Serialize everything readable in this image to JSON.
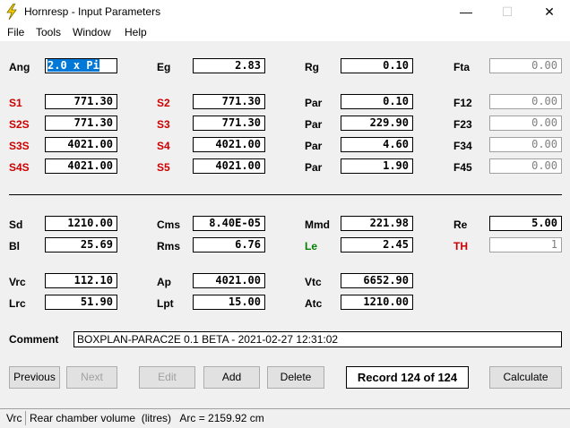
{
  "window": {
    "title": "Hornresp - Input Parameters",
    "minimize": "—",
    "maximize": "☐",
    "close": "✕",
    "icon": "lightning-icon"
  },
  "menu": {
    "file": "File",
    "tools": "Tools",
    "window": "Window",
    "help": "Help"
  },
  "params": {
    "ang": {
      "label": "Ang",
      "value": "2.0 x Pi"
    },
    "eg": {
      "label": "Eg",
      "value": "2.83"
    },
    "rg": {
      "label": "Rg",
      "value": "0.10"
    },
    "fta": {
      "label": "Fta",
      "value": "0.00"
    },
    "s1": {
      "label": "S1",
      "value": "771.30"
    },
    "s2": {
      "label": "S2",
      "value": "771.30"
    },
    "par1": {
      "label": "Par",
      "value": "0.10"
    },
    "f12": {
      "label": "F12",
      "value": "0.00"
    },
    "s2s": {
      "label": "S2S",
      "value": "771.30"
    },
    "s3": {
      "label": "S3",
      "value": "771.30"
    },
    "par2": {
      "label": "Par",
      "value": "229.90"
    },
    "f23": {
      "label": "F23",
      "value": "0.00"
    },
    "s3s": {
      "label": "S3S",
      "value": "4021.00"
    },
    "s4": {
      "label": "S4",
      "value": "4021.00"
    },
    "par3": {
      "label": "Par",
      "value": "4.60"
    },
    "f34": {
      "label": "F34",
      "value": "0.00"
    },
    "s4s": {
      "label": "S4S",
      "value": "4021.00"
    },
    "s5": {
      "label": "S5",
      "value": "4021.00"
    },
    "par4": {
      "label": "Par",
      "value": "1.90"
    },
    "f45": {
      "label": "F45",
      "value": "0.00"
    },
    "sd": {
      "label": "Sd",
      "value": "1210.00"
    },
    "cms": {
      "label": "Cms",
      "value": "8.40E-05"
    },
    "mmd": {
      "label": "Mmd",
      "value": "221.98"
    },
    "re": {
      "label": "Re",
      "value": "5.00"
    },
    "bl": {
      "label": "Bl",
      "value": "25.69"
    },
    "rms": {
      "label": "Rms",
      "value": "6.76"
    },
    "le": {
      "label": "Le",
      "value": "2.45"
    },
    "th": {
      "label": "TH",
      "value": "1"
    },
    "vrc": {
      "label": "Vrc",
      "value": "112.10"
    },
    "ap": {
      "label": "Ap",
      "value": "4021.00"
    },
    "vtc": {
      "label": "Vtc",
      "value": "6652.90"
    },
    "lrc": {
      "label": "Lrc",
      "value": "51.90"
    },
    "lpt": {
      "label": "Lpt",
      "value": "15.00"
    },
    "atc": {
      "label": "Atc",
      "value": "1210.00"
    }
  },
  "comment": {
    "label": "Comment",
    "value": "BOXPLAN-PARAC2E 0.1 BETA - 2021-02-27 12:31:02"
  },
  "buttons": {
    "previous": "Previous",
    "next": "Next",
    "edit": "Edit",
    "add": "Add",
    "delete": "Delete",
    "record": "Record 124 of 124",
    "calculate": "Calculate"
  },
  "status": {
    "field": "Vrc",
    "description": "Rear chamber volume  (litres)   Arc = 2159.92 cm"
  },
  "colors": {
    "accent_label": "#cc0000",
    "le_label": "#008000",
    "selection": "#0078d7",
    "title_icon": "#f5d000"
  }
}
